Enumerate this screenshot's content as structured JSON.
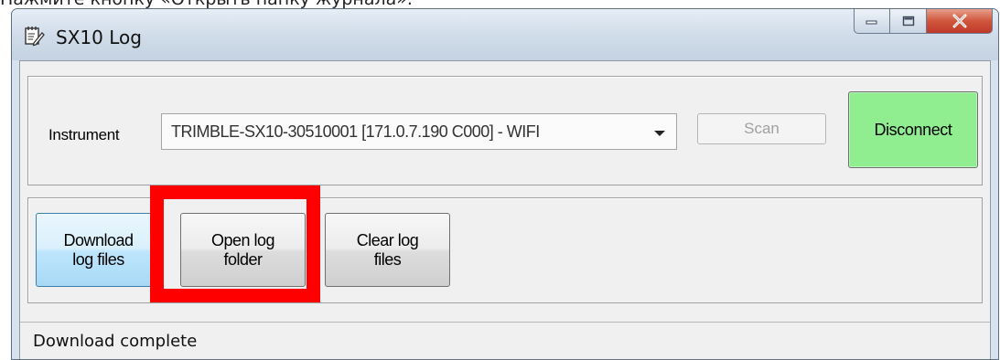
{
  "caption": "Нажмите кнопку «Открыть папку журнала».",
  "window": {
    "title": "SX10 Log"
  },
  "instrument": {
    "label": "Instrument",
    "selected": "TRIMBLE-SX10-30510001 [171.0.7.190 C000] - WIFI"
  },
  "buttons": {
    "scan": "Scan",
    "disconnect": "Disconnect",
    "download_line1": "Download",
    "download_line2": "log files",
    "open_line1": "Open log",
    "open_line2": "folder",
    "clear_line1": "Clear log",
    "clear_line2": "files"
  },
  "status": {
    "text": "Download complete"
  },
  "colors": {
    "disconnect_bg": "#90ee90",
    "highlight": "#ff0000",
    "close_button": "#c0392b"
  }
}
